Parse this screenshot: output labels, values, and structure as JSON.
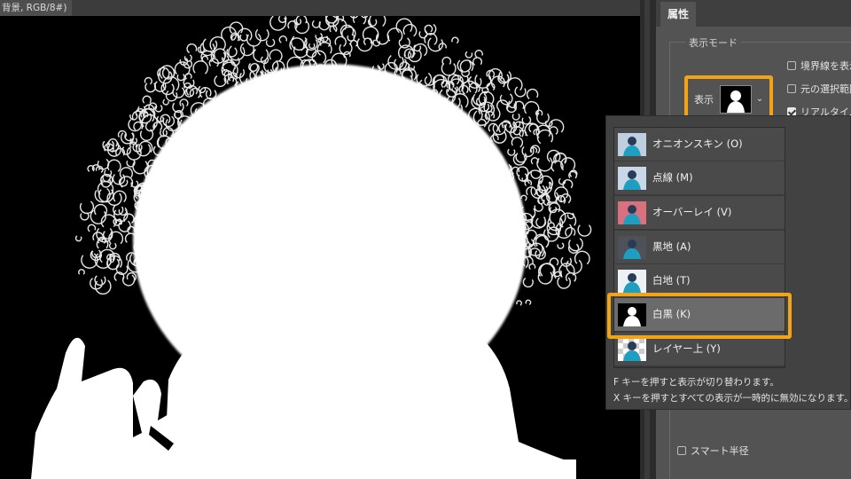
{
  "document": {
    "tab_title": "背景, RGB/8#)"
  },
  "panel": {
    "tab_label": "属性",
    "section_title": "表示モード",
    "view_label": "表示",
    "checkboxes": [
      {
        "label": "境界線を表示",
        "checked": false
      },
      {
        "label": "元の選択範囲",
        "checked": false
      },
      {
        "label": "リアルタイム",
        "checked": true
      }
    ],
    "smart_radius_label": "スマート半径"
  },
  "view_modes": [
    {
      "label": "オニオンスキン (O)",
      "thumb": "onion-skin"
    },
    {
      "label": "点線 (M)",
      "thumb": "marching-ants"
    },
    {
      "label": "オーバーレイ (V)",
      "thumb": "overlay"
    },
    {
      "label": "黒地 (A)",
      "thumb": "on-black"
    },
    {
      "label": "白地 (T)",
      "thumb": "on-white"
    },
    {
      "label": "白黒 (K)",
      "thumb": "black-white",
      "selected": true
    },
    {
      "label": "レイヤー上 (Y)",
      "thumb": "on-layers"
    }
  ],
  "notes": [
    "F キーを押すと表示が切り替わります。",
    "X キーを押すとすべての表示が一時的に無効になります。"
  ],
  "colors": {
    "highlight": "#f3a316",
    "panel": "#535353",
    "canvas": "#000000"
  }
}
